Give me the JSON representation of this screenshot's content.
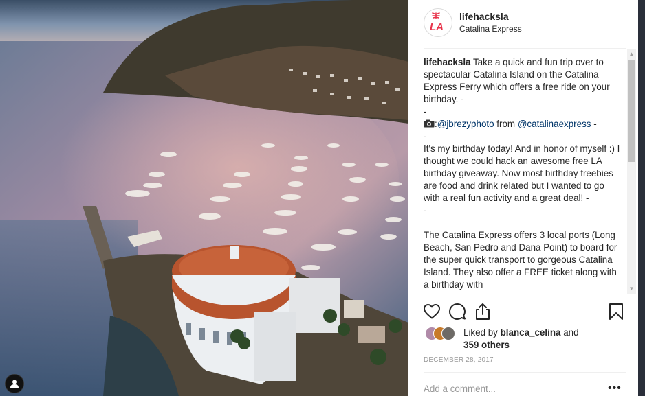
{
  "post": {
    "username": "lifehacksla",
    "location": "Catalina Express",
    "logo_text": "LA",
    "caption": {
      "username": "lifehacksla",
      "lines": [
        "Take a quick and fun trip over to spectacular Catalina Island on the Catalina Express Ferry which offers a free ride on your birthday. -",
        "-"
      ],
      "credit_prefix": ":",
      "credit_photographer": "@jbrezyphoto",
      "credit_from": "from",
      "credit_source": "@catalinaexpress",
      "credit_suffix": "-",
      "dash": "-",
      "paragraph2": "It's my birthday today! And in honor of myself :) I thought we could hack an awesome free LA birthday giveaway. Now most birthday freebies are food and drink related but I wanted to go with a real fun activity and a great deal! -",
      "paragraph3": "The Catalina Express offers 3 local ports (Long Beach, San Pedro and Dana Point) to board for the super quick transport to gorgeous Catalina Island. They also offer a FREE ticket along with a birthday with"
    },
    "likes": {
      "liked_by_prefix": "Liked by",
      "liked_by_user": "blanca_celina",
      "and": "and",
      "others": "359 others"
    },
    "date": "DECEMBER 28, 2017",
    "comment_placeholder": "Add a comment...",
    "more_label": "•••"
  },
  "icons": [
    "heart-icon",
    "comment-icon",
    "share-icon",
    "bookmark-icon",
    "profile-icon",
    "camera-icon"
  ],
  "colors": {
    "link": "#003569",
    "text": "#262626",
    "muted": "#999999",
    "logo_red": "#e8334a"
  }
}
